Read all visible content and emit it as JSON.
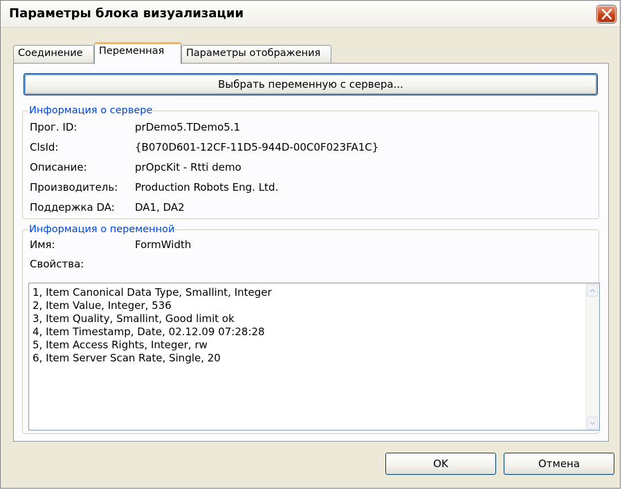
{
  "window": {
    "title": "Параметры блока визуализации"
  },
  "tabs": [
    {
      "label": "Соединение",
      "active": false
    },
    {
      "label": "Переменная",
      "active": true
    },
    {
      "label": "Параметры отображения",
      "active": false
    }
  ],
  "select_button": {
    "label": "Выбрать переменную с сервера..."
  },
  "server_info": {
    "title": "Информация о сервере",
    "rows": [
      {
        "label": "Прог. ID:",
        "value": "prDemo5.TDemo5.1"
      },
      {
        "label": "ClsId:",
        "value": "{B070D601-12CF-11D5-944D-00C0F023FA1C}"
      },
      {
        "label": "Описание:",
        "value": "prOpcKit - Rtti demo"
      },
      {
        "label": "Производитель:",
        "value": "Production Robots Eng. Ltd."
      },
      {
        "label": "Поддержка DA:",
        "value": "DA1, DA2"
      }
    ]
  },
  "variable_info": {
    "title": "Информация о переменной",
    "name_label": "Имя:",
    "name_value": "FormWidth",
    "properties_label": "Свойства:",
    "properties": [
      "1, Item Canonical Data Type, Smallint, Integer",
      "2, Item Value, Integer, 536",
      "3, Item Quality, Smallint, Good limit ok",
      "4, Item Timestamp, Date, 02.12.09 07:28:28",
      "5, Item Access Rights, Integer, rw",
      "6, Item Server Scan Rate, Single, 20"
    ]
  },
  "buttons": {
    "ok_label": "OK",
    "cancel_label": "Отмена"
  },
  "colors": {
    "group_title": "#0046d5",
    "active_tab_accent": "#f7b648",
    "close_button": "#c8451d"
  },
  "icons": {
    "close": "close-icon",
    "scroll_up": "chevron-up-icon",
    "scroll_down": "chevron-down-icon"
  }
}
